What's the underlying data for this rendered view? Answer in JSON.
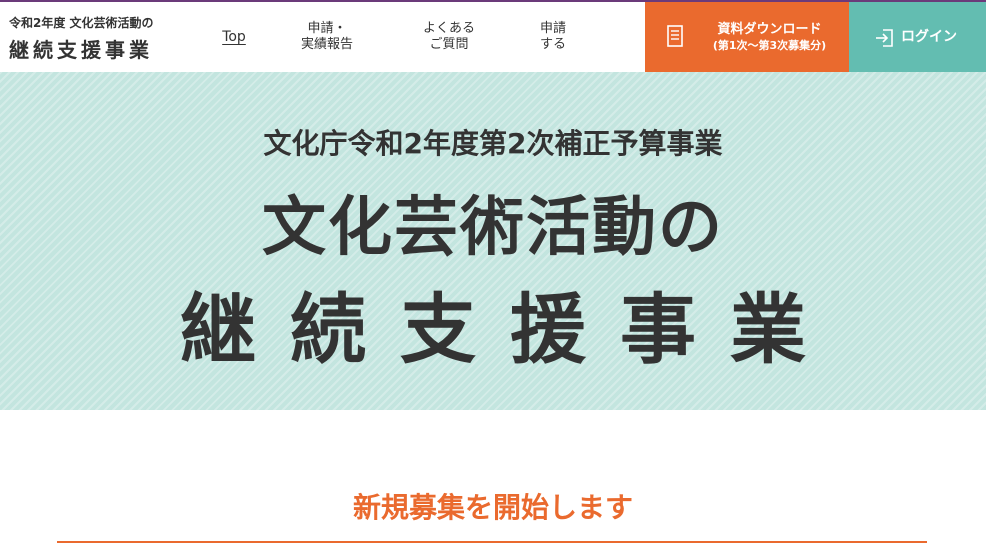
{
  "colors": {
    "accent_orange": "#ea6a2e",
    "accent_teal": "#63bdb1",
    "hero_bg": "#c3e5df",
    "text": "#333333",
    "top_line": "#6b3a7a"
  },
  "logo": {
    "small": "令和2年度  文化芸術活動の",
    "big": "継続支援事業"
  },
  "nav": {
    "top": "Top",
    "report_line1": "申請・",
    "report_line2": "実績報告",
    "faq_line1": "よくある",
    "faq_line2": "ご質問",
    "apply_line1": "申請",
    "apply_line2": "する"
  },
  "download": {
    "icon": "document-icon",
    "label": "資料ダウンロード",
    "sub": "(第1次～第3次募集分)"
  },
  "login": {
    "icon": "login-icon",
    "label": "ログイン"
  },
  "hero": {
    "subtitle": "文化庁令和2年度第2次補正予算事業",
    "title_line1": "文化芸術活動の",
    "title_line2": "継続支援事業"
  },
  "notice": {
    "heading": "新規募集を開始します"
  }
}
